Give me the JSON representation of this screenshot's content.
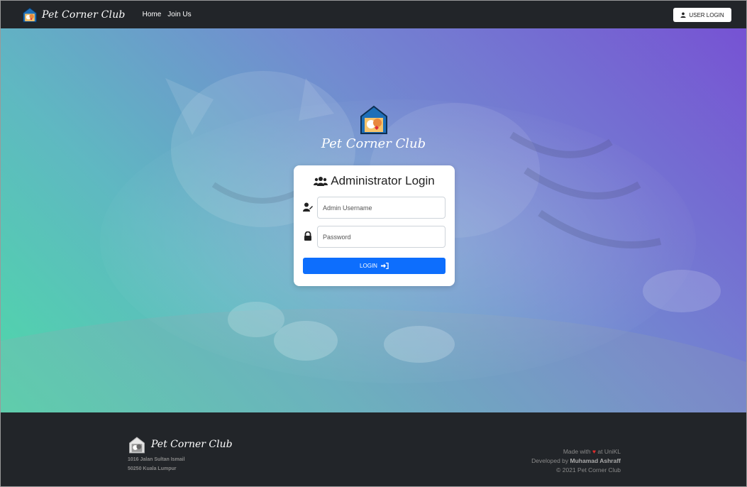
{
  "navbar": {
    "brand": "Pet Corner Club",
    "links": [
      "Home",
      "Join Us"
    ],
    "user_login": "USER LOGIN"
  },
  "hero": {
    "title": "Pet Corner Club"
  },
  "login": {
    "title": "Administrator Login",
    "username_placeholder": "Admin Username",
    "password_placeholder": "Password",
    "submit": "LOGIN"
  },
  "footer": {
    "brand": "Pet Corner Club",
    "address_line1": "1016 Jalan Sultan Ismail",
    "address_line2": "50250 Kuala Lumpur",
    "made_with_prefix": "Made with",
    "made_with_suffix": "at UniKL",
    "developed_prefix": "Developed by",
    "developer": "Muhamad Ashraff",
    "copyright": "© 2021 Pet Corner Club"
  },
  "colors": {
    "navbar_bg": "#222529",
    "primary": "#0d6efd",
    "heart": "#e12c2c",
    "gradient_start": "#4fd6a8",
    "gradient_end": "#7a59d4"
  },
  "icons": {
    "logo": "pet-house-logo-icon",
    "user_login": "user-icon",
    "card_title": "users-icon",
    "username": "user-edit-icon",
    "password": "lock-icon",
    "submit": "sign-in-icon",
    "heart": "heart-icon"
  }
}
